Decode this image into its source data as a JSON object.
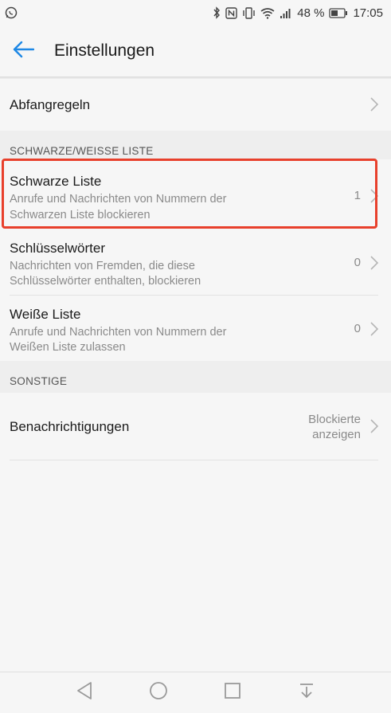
{
  "status_bar": {
    "battery": "48 %",
    "time": "17:05"
  },
  "app_bar": {
    "title": "Einstellungen"
  },
  "rows": {
    "abfangregeln": {
      "label": "Abfangregeln"
    },
    "schwarze_liste": {
      "label": "Schwarze Liste",
      "subtitle_1": "Anrufe und Nachrichten von Nummern der",
      "subtitle_2": "Schwarzen Liste blockieren",
      "count": "1"
    },
    "schluesselwoerter": {
      "label": "Schlüsselwörter",
      "subtitle_1": "Nachrichten von Fremden, die diese",
      "subtitle_2": "Schlüsselwörter enthalten, blockieren",
      "count": "0"
    },
    "weisse_liste": {
      "label": "Weiße Liste",
      "subtitle_1": "Anrufe und Nachrichten von Nummern der",
      "subtitle_2": "Weißen Liste zulassen",
      "count": "0"
    },
    "benachrichtigungen": {
      "label": "Benachrichtigungen",
      "value_1": "Blockierte",
      "value_2": "anzeigen"
    }
  },
  "sections": {
    "black_white": "SCHWARZE/WEISSE LISTE",
    "other": "SONSTIGE"
  },
  "colors": {
    "accent": "#1e88e5",
    "highlight": "#e8402c"
  }
}
